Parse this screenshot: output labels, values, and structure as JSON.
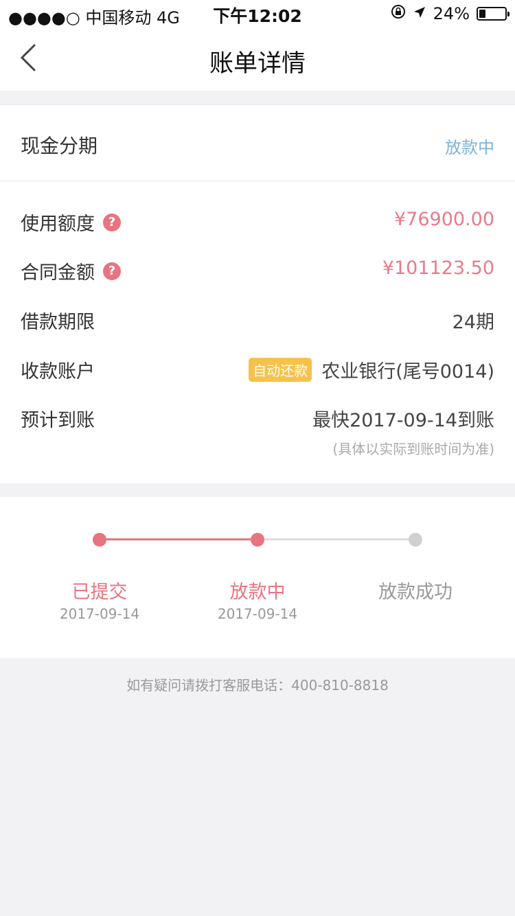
{
  "status_bar": {
    "carrier": "●●●●○ 中国移动   4G",
    "time": "下午12:02",
    "battery_percent": "24%",
    "battery_level": 0.24
  },
  "nav": {
    "title": "账单详情",
    "back_icon": "chevron-left-icon"
  },
  "product": {
    "label": "现金分期",
    "status": "放款中"
  },
  "details": [
    {
      "label": "使用额度",
      "value": "¥76900.00",
      "help": true
    },
    {
      "label": "合同金额",
      "value": "¥101123.50",
      "help": true
    },
    {
      "label": "借款期限",
      "value": "24期",
      "help": false
    },
    {
      "label": "收款账户",
      "value": "农业银行(尾号0014)",
      "badge": "自动还款",
      "help": false
    },
    {
      "label": "预计到账",
      "value": "最快2017-09-14到账",
      "help": false
    }
  ],
  "arrival_note": "(具体以实际到账时间为准)",
  "progress": {
    "steps": [
      {
        "label": "已提交",
        "date": "2017-09-14",
        "done": true
      },
      {
        "label": "放款中",
        "date": "2017-09-14",
        "done": true
      },
      {
        "label": "放款成功",
        "date": "",
        "done": false
      }
    ]
  },
  "footer": {
    "hotline_text": "如有疑问请拨打客服电话：400-810-8818"
  },
  "colors": {
    "accent_red": "#e9737f",
    "status_blue": "#7ab3d6",
    "badge_yellow": "#f5c24c",
    "inactive_gray": "#cfcfcf"
  }
}
